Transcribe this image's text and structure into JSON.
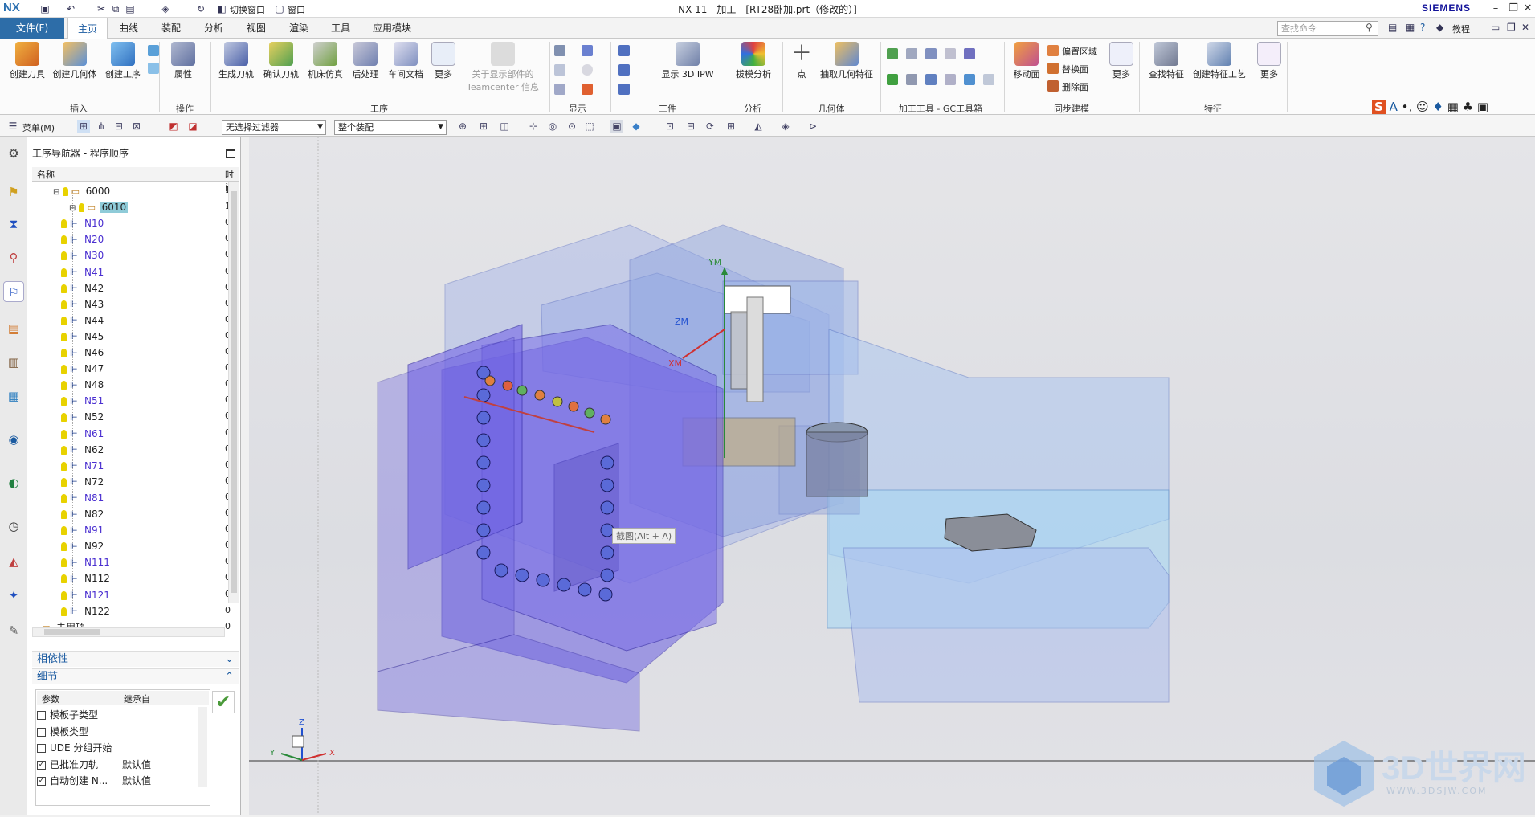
{
  "title_bar": {
    "logo": "NX",
    "switch_window": "切换窗口",
    "window": "窗口",
    "title": "NX 11 - 加工 - [RT28卧加.prt（修改的）]",
    "brand": "SIEMENS"
  },
  "menu": {
    "file": "文件(F)",
    "tabs": [
      "主页",
      "曲线",
      "装配",
      "分析",
      "视图",
      "渲染",
      "工具",
      "应用模块"
    ],
    "active_tab": "主页",
    "search_placeholder": "查找命令",
    "tutorial": "教程"
  },
  "ribbon": {
    "groups": [
      {
        "label": "插入",
        "buttons": [
          "创建刀具",
          "创建几何体",
          "创建工序"
        ]
      },
      {
        "label": "操作",
        "buttons": [
          "属性"
        ]
      },
      {
        "label": "工序",
        "buttons": [
          "生成刀轨",
          "确认刀轨",
          "机床仿真",
          "后处理",
          "车间文档",
          "更多",
          "关于显示部件的 Teamcenter 信息"
        ]
      },
      {
        "label": "显示",
        "buttons": []
      },
      {
        "label": "工件",
        "buttons": [
          "显示 3D IPW"
        ]
      },
      {
        "label": "分析",
        "buttons": [
          "拔模分析"
        ]
      },
      {
        "label": "几何体",
        "buttons": [
          "点",
          "抽取几何特征"
        ]
      },
      {
        "label": "加工工具 - GC工具箱",
        "buttons": []
      },
      {
        "label": "同步建模",
        "buttons": [
          "移动面",
          "偏置区域",
          "替换面",
          "删除面",
          "更多"
        ]
      },
      {
        "label": "特征",
        "buttons": [
          "查找特征",
          "创建特征工艺",
          "更多"
        ]
      }
    ]
  },
  "toolbar2": {
    "menu": "菜单(M)",
    "filter": "无选择过滤器",
    "scope": "整个装配"
  },
  "navigator": {
    "title": "工序导航器 - 程序顺序",
    "columns": [
      "名称",
      "时间"
    ],
    "rows": [
      {
        "name": "6000",
        "time": "1"
      },
      {
        "name": "6010",
        "time": "1"
      },
      {
        "name": "N10",
        "time": "0"
      },
      {
        "name": "N20",
        "time": "0"
      },
      {
        "name": "N30",
        "time": "0"
      },
      {
        "name": "N41",
        "time": "0"
      },
      {
        "name": "N42",
        "time": "0"
      },
      {
        "name": "N43",
        "time": "0"
      },
      {
        "name": "N44",
        "time": "0"
      },
      {
        "name": "N45",
        "time": "0"
      },
      {
        "name": "N46",
        "time": "0"
      },
      {
        "name": "N47",
        "time": "0"
      },
      {
        "name": "N48",
        "time": "0"
      },
      {
        "name": "N51",
        "time": "0"
      },
      {
        "name": "N52",
        "time": "0"
      },
      {
        "name": "N61",
        "time": "0"
      },
      {
        "name": "N62",
        "time": "0"
      },
      {
        "name": "N71",
        "time": "0"
      },
      {
        "name": "N72",
        "time": "0"
      },
      {
        "name": "N81",
        "time": "0"
      },
      {
        "name": "N82",
        "time": "0"
      },
      {
        "name": "N91",
        "time": "0"
      },
      {
        "name": "N92",
        "time": "0"
      },
      {
        "name": "N111",
        "time": "0"
      },
      {
        "name": "N112",
        "time": "0"
      },
      {
        "name": "N121",
        "time": "0"
      },
      {
        "name": "N122",
        "time": "0"
      },
      {
        "name": "未用项",
        "time": "0"
      }
    ],
    "dependencies": "相依性",
    "details": "细节",
    "detail_columns": [
      "参数",
      "继承自"
    ],
    "details_rows": [
      {
        "param": "模板子类型",
        "from": "",
        "checked": false
      },
      {
        "param": "模板类型",
        "from": "",
        "checked": false
      },
      {
        "param": "UDE 分组开始",
        "from": "",
        "checked": false
      },
      {
        "param": "已批准刀轨",
        "from": "默认值",
        "checked": true
      },
      {
        "param": "自动创建 N...",
        "from": "默认值",
        "checked": true
      }
    ]
  },
  "viewport": {
    "tooltip": "截图(Alt + A)",
    "axis_labels": [
      "YM",
      "ZM",
      "XM"
    ],
    "triad": [
      "Z",
      "Y",
      "X"
    ],
    "watermark": "3D世界网",
    "watermark_url": "WWW.3DSJW.COM"
  },
  "colors": {
    "accent": "#2d6da8",
    "selection": "#8fcbd8",
    "machine_blue": "#7f96dc",
    "enclosure_violet": "#6a5fe0"
  }
}
